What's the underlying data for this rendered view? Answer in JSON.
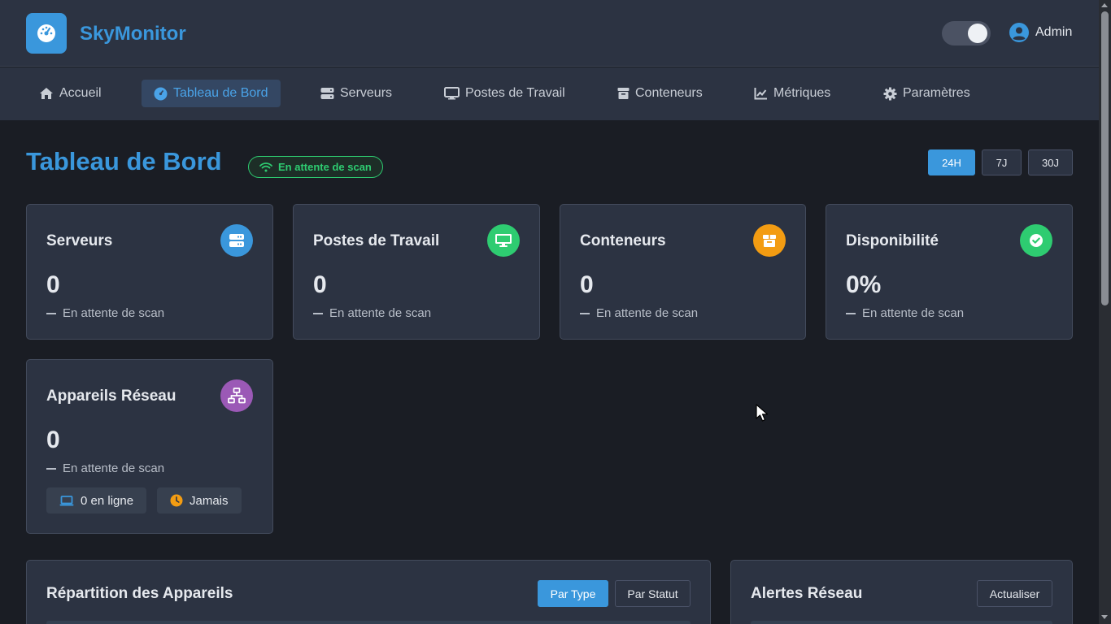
{
  "header": {
    "app_title": "SkyMonitor",
    "user_name": "Admin",
    "theme_toggle_on": true
  },
  "nav": {
    "items": [
      {
        "label": "Accueil",
        "icon": "home-icon",
        "active": false
      },
      {
        "label": "Tableau de Bord",
        "icon": "dashboard-icon",
        "active": true
      },
      {
        "label": "Serveurs",
        "icon": "server-icon",
        "active": false
      },
      {
        "label": "Postes de Travail",
        "icon": "desktop-icon",
        "active": false
      },
      {
        "label": "Conteneurs",
        "icon": "box-icon",
        "active": false
      },
      {
        "label": "Métriques",
        "icon": "chart-line-icon",
        "active": false
      },
      {
        "label": "Paramètres",
        "icon": "gear-icon",
        "active": false
      }
    ]
  },
  "page": {
    "title": "Tableau de Bord",
    "status": "En attente de scan",
    "ranges": [
      "24H",
      "7J",
      "30J"
    ],
    "active_range": "24H"
  },
  "cards": [
    {
      "title": "Serveurs",
      "value": "0",
      "sub": "En attente de scan",
      "icon": "server-icon",
      "color": "#3a97dc"
    },
    {
      "title": "Postes de Travail",
      "value": "0",
      "sub": "En attente de scan",
      "icon": "desktop-icon",
      "color": "#2ecc71"
    },
    {
      "title": "Conteneurs",
      "value": "0",
      "sub": "En attente de scan",
      "icon": "box-icon",
      "color": "#f39c12"
    },
    {
      "title": "Disponibilité",
      "value": "0%",
      "sub": "En attente de scan",
      "icon": "check-circle-icon",
      "color": "#2ecc71"
    },
    {
      "title": "Appareils Réseau",
      "value": "0",
      "sub": "En attente de scan",
      "icon": "network-icon",
      "color": "#9b59b6",
      "online": "0 en ligne",
      "last_scan": "Jamais"
    }
  ],
  "panels": {
    "distribution": {
      "title": "Répartition des Appareils",
      "btn_type": "Par Type",
      "btn_status": "Par Statut"
    },
    "alerts": {
      "title": "Alertes Réseau",
      "btn_refresh": "Actualiser"
    }
  },
  "colors": {
    "accent": "#3a97dc",
    "success": "#2ecc71",
    "warning": "#f39c12",
    "purple": "#9b59b6"
  }
}
